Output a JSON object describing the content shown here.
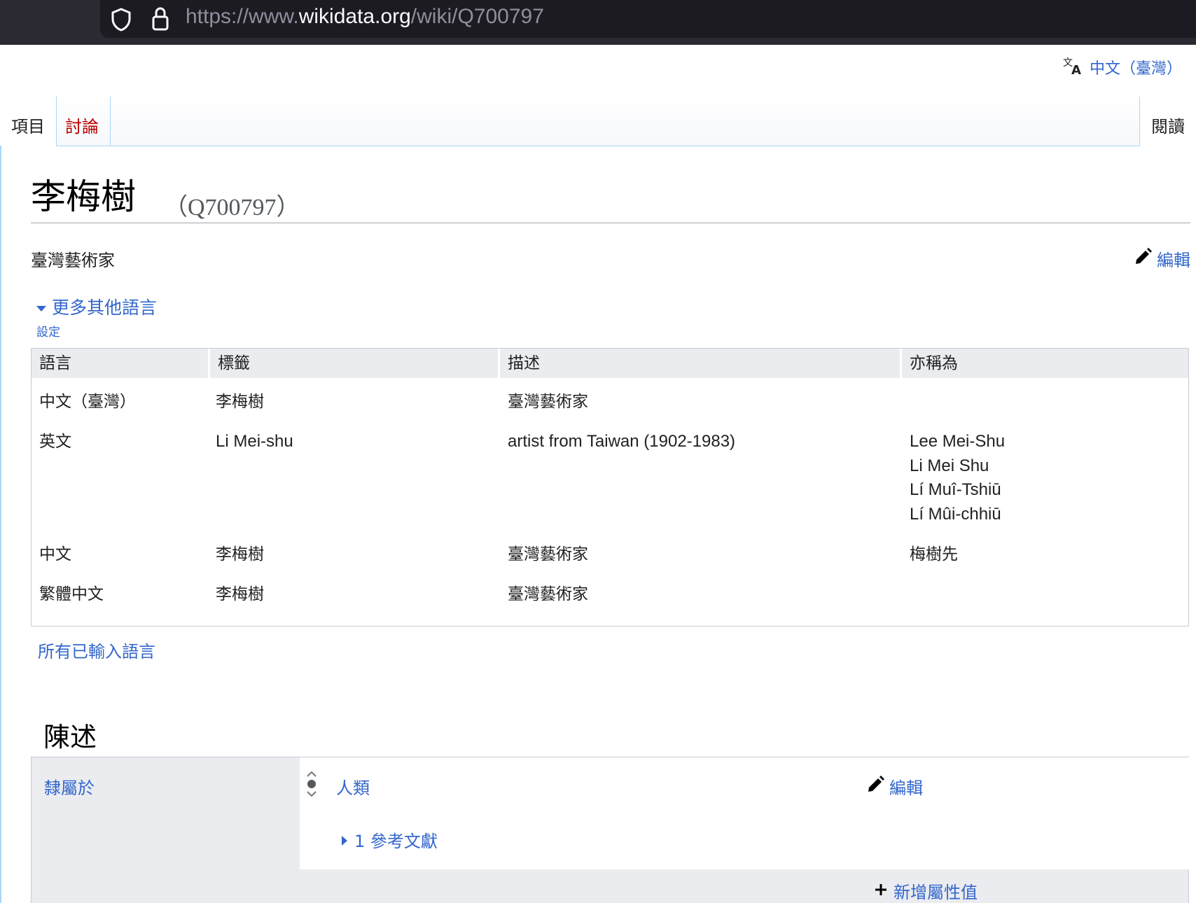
{
  "browser": {
    "url_prefix": "https://www.",
    "url_host": "wikidata.org",
    "url_path": "/wiki/Q700797"
  },
  "language_selector": {
    "label": "中文（臺灣）"
  },
  "tabs": {
    "item": "項目",
    "talk": "討論",
    "read": "閱讀"
  },
  "entity": {
    "label": "李梅樹",
    "id": "（Q700797）",
    "description": "臺灣藝術家",
    "edit": "編輯"
  },
  "terms": {
    "more_languages": "更多其他語言",
    "settings": "設定",
    "headers": [
      "語言",
      "標籤",
      "描述",
      "亦稱為"
    ],
    "rows": [
      {
        "language": "中文（臺灣）",
        "label": "李梅樹",
        "description": "臺灣藝術家",
        "aliases": []
      },
      {
        "language": "英文",
        "label": "Li Mei-shu",
        "description": "artist from Taiwan (1902-1983)",
        "aliases": [
          "Lee Mei-Shu",
          "Li Mei Shu",
          "Lí Muî-Tshiū",
          "Lí Mûi-chhiū"
        ]
      },
      {
        "language": "中文",
        "label": "李梅樹",
        "description": "臺灣藝術家",
        "aliases": [
          "梅樹先"
        ]
      },
      {
        "language": "繁體中文",
        "label": "李梅樹",
        "description": "臺灣藝術家",
        "aliases": []
      }
    ],
    "all_languages": "所有已輸入語言"
  },
  "statements": {
    "heading": "陳述",
    "claims": [
      {
        "property": "隸屬於",
        "value": "人類",
        "edit": "編輯",
        "references": "1 參考文獻",
        "add_value": "新增屬性值"
      }
    ]
  },
  "colors": {
    "link": "#3366cc",
    "talk_red": "#ba0000",
    "header_gray": "#eaecf0",
    "border": "#c8ccd1"
  }
}
